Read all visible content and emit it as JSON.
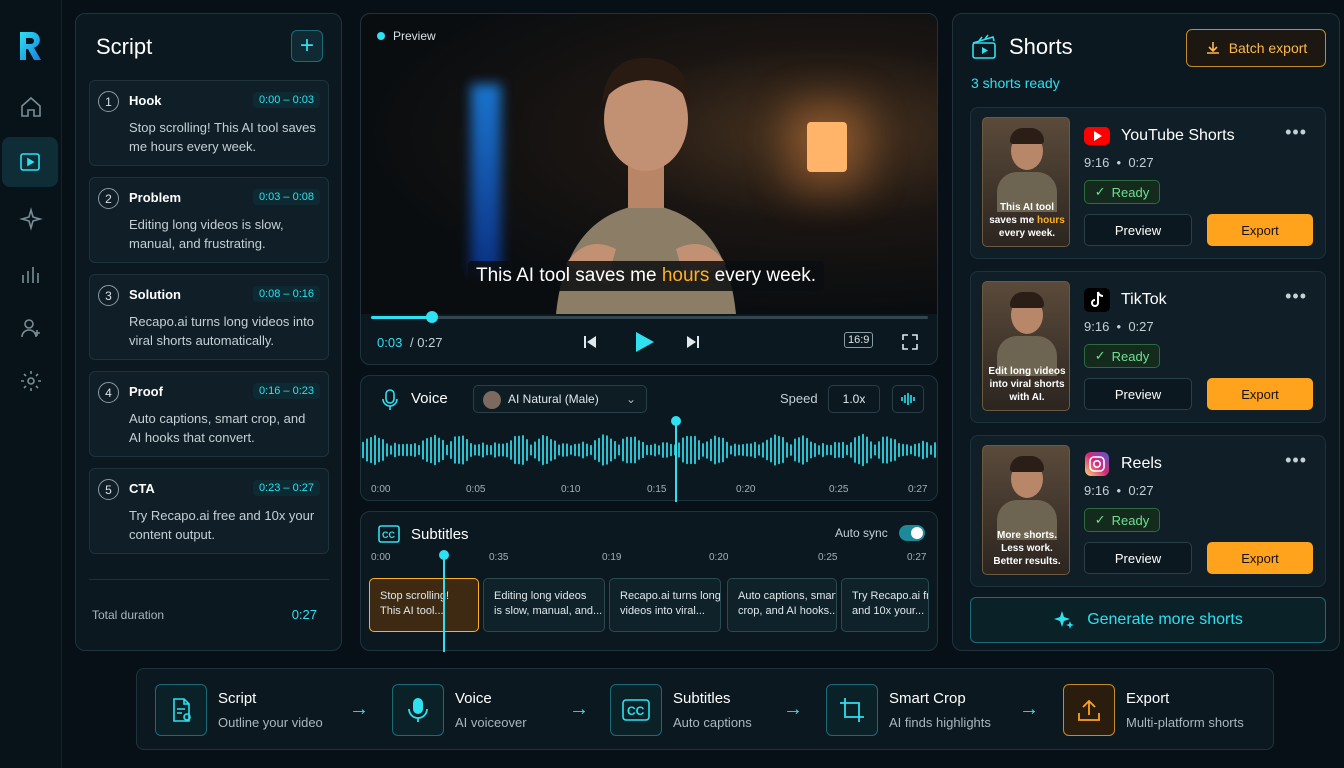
{
  "nav": {
    "logo": "R",
    "items": [
      "home-icon",
      "video-icon",
      "sparkle-icon",
      "chart-icon",
      "user-icon",
      "gear-icon"
    ]
  },
  "script": {
    "title": "Script",
    "items": [
      {
        "num": "1",
        "label": "Hook",
        "time": "0:00 – 0:03",
        "text": "Stop scrolling! This AI tool saves me hours every week."
      },
      {
        "num": "2",
        "label": "Problem",
        "time": "0:03 – 0:08",
        "text": "Editing long videos is slow, manual, and frustrating."
      },
      {
        "num": "3",
        "label": "Solution",
        "time": "0:08 – 0:16",
        "text": "Recapo.ai turns long videos into viral shorts automatically."
      },
      {
        "num": "4",
        "label": "Proof",
        "time": "0:16 – 0:23",
        "text": "Auto captions, smart crop, and AI hooks that convert."
      },
      {
        "num": "5",
        "label": "CTA",
        "time": "0:23 – 0:27",
        "text": "Try Recapo.ai free and 10x your content output."
      }
    ],
    "duration_label": "Total duration",
    "duration_value": "0:27"
  },
  "preview": {
    "label": "Preview",
    "caption_pre": "This AI tool saves me ",
    "caption_hl": "hours",
    "caption_post": " every week.",
    "current": "0:03",
    "total": "/ 0:27",
    "ratio": "16:9",
    "progress": 0.11
  },
  "voice": {
    "title": "Voice",
    "selected": "AI Natural (Male)",
    "speed_label": "Speed",
    "speed_value": "1.0x",
    "ticks": [
      "0:00",
      "0:05",
      "0:10",
      "0:15",
      "0:20",
      "0:25",
      "0:27"
    ]
  },
  "subtitles": {
    "title": "Subtitles",
    "autosync": "Auto sync",
    "ticks": [
      "0:00",
      "0:35",
      "0:19",
      "0:20",
      "0:25",
      "0:27"
    ],
    "chips": [
      [
        "Stop scrolling!",
        "This AI tool..."
      ],
      [
        "Editing long videos",
        "is slow, manual, and..."
      ],
      [
        "Recapo.ai turns long",
        "videos into viral..."
      ],
      [
        "Auto captions, smart",
        "crop, and AI hooks..."
      ],
      [
        "Try Recapo.ai free",
        "and 10x your..."
      ]
    ]
  },
  "shorts": {
    "title": "Shorts",
    "subtitle": "3 shorts ready",
    "batch": "Batch export",
    "generate": "Generate more shorts",
    "cards": [
      {
        "platform": "YouTube Shorts",
        "ratio": "9:16",
        "duration": "0:27",
        "status": "Ready",
        "preview": "Preview",
        "export": "Export",
        "caption_pre": "This AI tool saves me ",
        "caption_hl": "hours",
        "caption_post": " every week.",
        "color": "#ff0000"
      },
      {
        "platform": "TikTok",
        "ratio": "9:16",
        "duration": "0:27",
        "status": "Ready",
        "preview": "Preview",
        "export": "Export",
        "caption_pre": "Edit long videos into viral shorts with AI.",
        "caption_hl": "",
        "caption_post": "",
        "color": "#000000"
      },
      {
        "platform": "Reels",
        "ratio": "9:16",
        "duration": "0:27",
        "status": "Ready",
        "preview": "Preview",
        "export": "Export",
        "caption_pre": "More shorts. Less work. Better results.",
        "caption_hl": "",
        "caption_post": "",
        "color": "#d6249f"
      }
    ]
  },
  "pipeline": [
    {
      "title": "Script",
      "desc": "Outline your video",
      "icon": "document-icon"
    },
    {
      "title": "Voice",
      "desc": "AI voiceover",
      "icon": "microphone-icon"
    },
    {
      "title": "Subtitles",
      "desc": "Auto captions",
      "icon": "cc-icon"
    },
    {
      "title": "Smart Crop",
      "desc": "AI finds highlights",
      "icon": "crop-icon"
    },
    {
      "title": "Export",
      "desc": "Multi-platform shorts",
      "icon": "upload-icon"
    }
  ]
}
